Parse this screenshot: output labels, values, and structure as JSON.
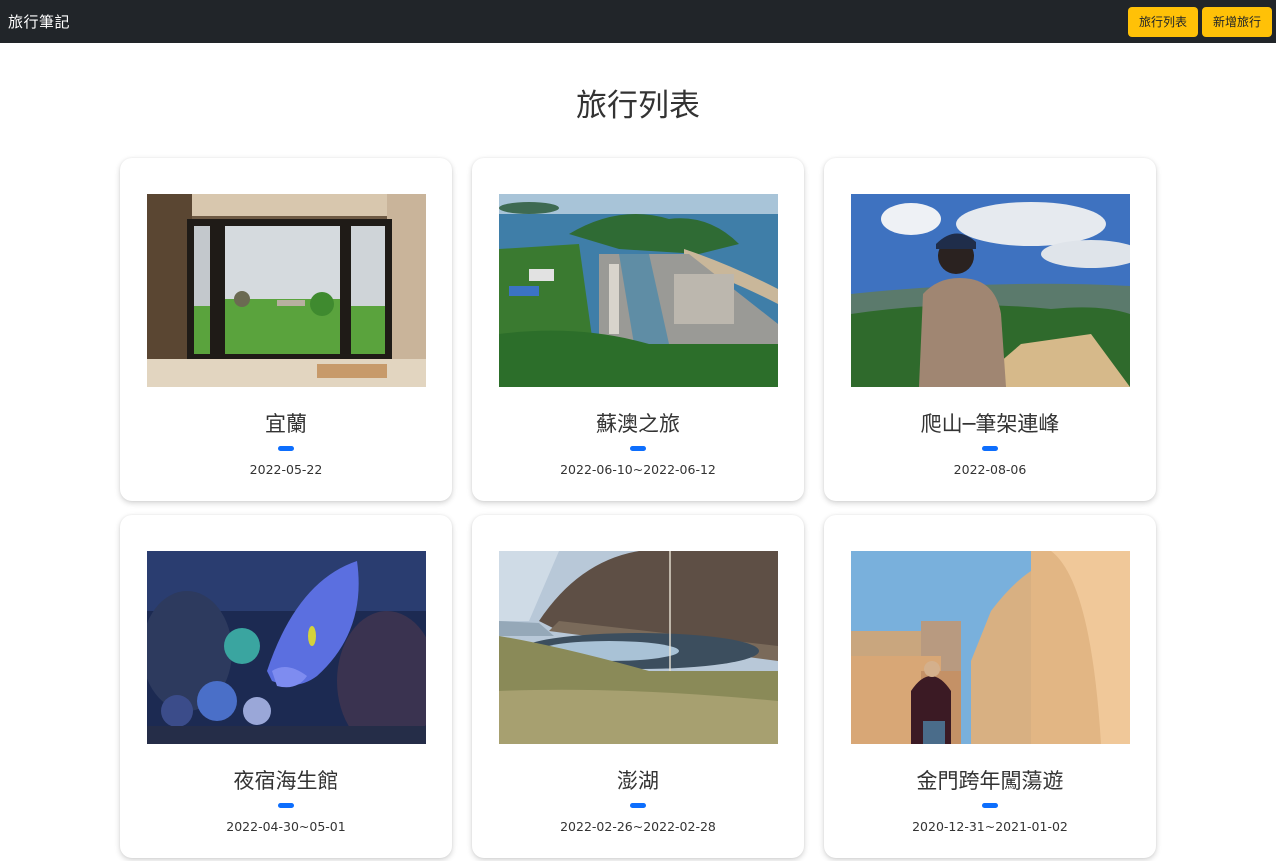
{
  "navbar": {
    "brand": "旅行筆記",
    "buttons": [
      {
        "label": "旅行列表"
      },
      {
        "label": "新增旅行"
      }
    ]
  },
  "page": {
    "title": "旅行列表"
  },
  "colors": {
    "navbar_bg": "#212529",
    "button_bg": "#ffc107",
    "accent": "#0d6efd"
  },
  "trips": [
    {
      "title": "宜蘭",
      "date": "2022-05-22"
    },
    {
      "title": "蘇澳之旅",
      "date": "2022-06-10~2022-06-12"
    },
    {
      "title": "爬山─筆架連峰",
      "date": "2022-08-06"
    },
    {
      "title": "夜宿海生館",
      "date": "2022-04-30~05-01"
    },
    {
      "title": "澎湖",
      "date": "2022-02-26~2022-02-28"
    },
    {
      "title": "金門跨年闖蕩遊",
      "date": "2020-12-31~2021-01-02"
    }
  ]
}
